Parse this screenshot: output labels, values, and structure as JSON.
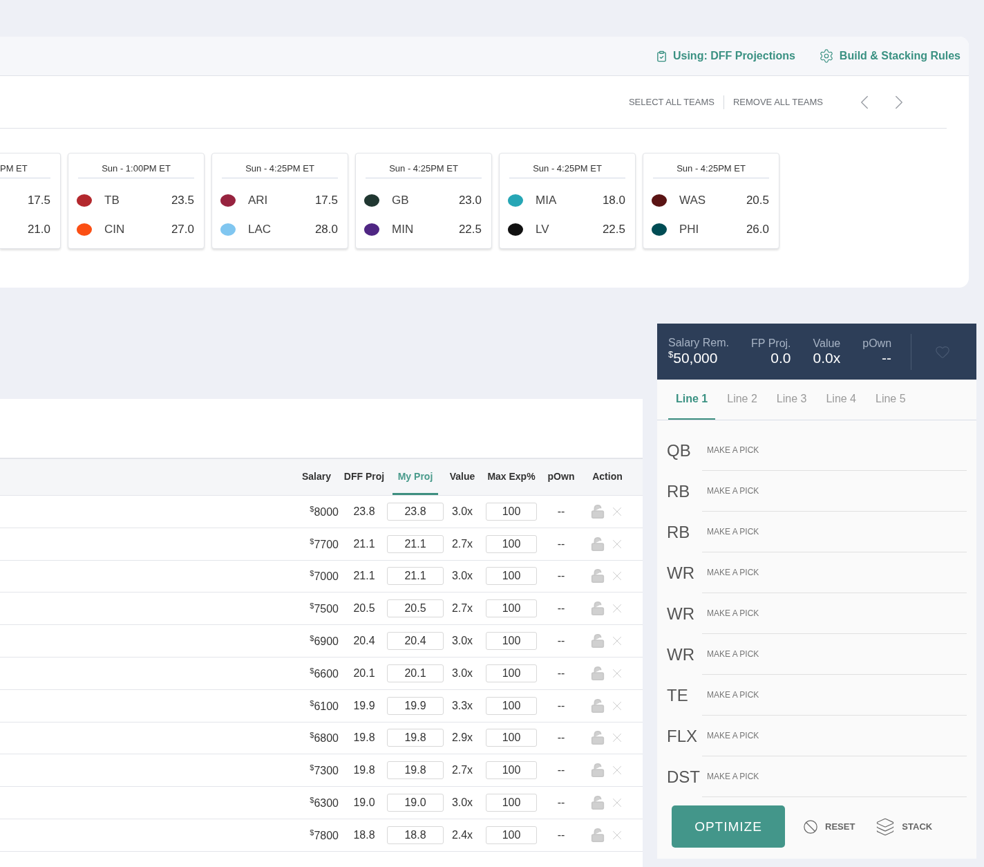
{
  "header_links": [
    {
      "kind": "projections",
      "label": "Using: DFF Projections"
    },
    {
      "kind": "rules",
      "label": "Build & Stacking Rules"
    }
  ],
  "team_actions": [
    "SELECT ALL TEAMS",
    "REMOVE ALL TEAMS"
  ],
  "games": [
    {
      "kind": "partial",
      "time": "PM ET",
      "teams": [
        {
          "score": "17.5"
        },
        {
          "score": "21.0"
        }
      ]
    },
    {
      "kind": "full",
      "time": "Sun - 1:00PM ET",
      "teams": [
        {
          "abbr": "TB",
          "score": "23.5",
          "color": "#b3282d"
        },
        {
          "abbr": "CIN",
          "score": "27.0",
          "color": "#fb4f14"
        }
      ]
    },
    {
      "kind": "full",
      "time": "Sun - 4:25PM ET",
      "teams": [
        {
          "abbr": "ARI",
          "score": "17.5",
          "color": "#97233f"
        },
        {
          "abbr": "LAC",
          "score": "28.0",
          "color": "#80c6f0"
        }
      ]
    },
    {
      "kind": "full",
      "time": "Sun - 4:25PM ET",
      "teams": [
        {
          "abbr": "GB",
          "score": "23.0",
          "color": "#203731"
        },
        {
          "abbr": "MIN",
          "score": "22.5",
          "color": "#4f2683"
        }
      ]
    },
    {
      "kind": "full",
      "time": "Sun - 4:25PM ET",
      "teams": [
        {
          "abbr": "MIA",
          "score": "18.0",
          "color": "#26a6b5"
        },
        {
          "abbr": "LV",
          "score": "22.5",
          "color": "#111111"
        }
      ]
    },
    {
      "kind": "full",
      "time": "Sun - 4:25PM ET",
      "teams": [
        {
          "abbr": "WAS",
          "score": "20.5",
          "color": "#5a1414"
        },
        {
          "abbr": "PHI",
          "score": "26.0",
          "color": "#004c54"
        }
      ]
    }
  ],
  "table": {
    "columns": [
      {
        "label": "Salary",
        "selected": false
      },
      {
        "label": "DFF Proj",
        "selected": false
      },
      {
        "label": "My Proj",
        "selected": true
      },
      {
        "label": "Value",
        "selected": false
      },
      {
        "label": "Max Exp%",
        "selected": false
      },
      {
        "label": "pOwn",
        "selected": false
      },
      {
        "label": "Action",
        "selected": false
      }
    ],
    "rows": [
      {
        "currency": "$",
        "salary": "8000",
        "dff_proj": "23.8",
        "my_proj": "23.8",
        "value": "3.0x",
        "max_exp": "100",
        "pown": "--"
      },
      {
        "currency": "$",
        "salary": "7700",
        "dff_proj": "21.1",
        "my_proj": "21.1",
        "value": "2.7x",
        "max_exp": "100",
        "pown": "--"
      },
      {
        "currency": "$",
        "salary": "7000",
        "dff_proj": "21.1",
        "my_proj": "21.1",
        "value": "3.0x",
        "max_exp": "100",
        "pown": "--"
      },
      {
        "currency": "$",
        "salary": "7500",
        "dff_proj": "20.5",
        "my_proj": "20.5",
        "value": "2.7x",
        "max_exp": "100",
        "pown": "--"
      },
      {
        "currency": "$",
        "salary": "6900",
        "dff_proj": "20.4",
        "my_proj": "20.4",
        "value": "3.0x",
        "max_exp": "100",
        "pown": "--"
      },
      {
        "currency": "$",
        "salary": "6600",
        "dff_proj": "20.1",
        "my_proj": "20.1",
        "value": "3.0x",
        "max_exp": "100",
        "pown": "--"
      },
      {
        "currency": "$",
        "salary": "6100",
        "dff_proj": "19.9",
        "my_proj": "19.9",
        "value": "3.3x",
        "max_exp": "100",
        "pown": "--"
      },
      {
        "currency": "$",
        "salary": "6800",
        "dff_proj": "19.8",
        "my_proj": "19.8",
        "value": "2.9x",
        "max_exp": "100",
        "pown": "--"
      },
      {
        "currency": "$",
        "salary": "7300",
        "dff_proj": "19.8",
        "my_proj": "19.8",
        "value": "2.7x",
        "max_exp": "100",
        "pown": "--"
      },
      {
        "currency": "$",
        "salary": "6300",
        "dff_proj": "19.0",
        "my_proj": "19.0",
        "value": "3.0x",
        "max_exp": "100",
        "pown": "--"
      },
      {
        "currency": "$",
        "salary": "7800",
        "dff_proj": "18.8",
        "my_proj": "18.8",
        "value": "2.4x",
        "max_exp": "100",
        "pown": "--"
      }
    ]
  },
  "lineup": {
    "stats": [
      {
        "label": "Salary Rem.",
        "currency": "$",
        "value": "50,000"
      },
      {
        "label": "FP Proj.",
        "value": "0.0"
      },
      {
        "label": "Value",
        "value": "0.0x"
      },
      {
        "label": "pOwn",
        "value": "--"
      }
    ],
    "tabs": [
      {
        "label": "Line 1",
        "selected": true
      },
      {
        "label": "Line 2",
        "selected": false
      },
      {
        "label": "Line 3",
        "selected": false
      },
      {
        "label": "Line 4",
        "selected": false
      },
      {
        "label": "Line 5",
        "selected": false
      }
    ],
    "slots": [
      {
        "position": "QB",
        "placeholder": "MAKE A PICK"
      },
      {
        "position": "RB",
        "placeholder": "MAKE A PICK"
      },
      {
        "position": "RB",
        "placeholder": "MAKE A PICK"
      },
      {
        "position": "WR",
        "placeholder": "MAKE A PICK"
      },
      {
        "position": "WR",
        "placeholder": "MAKE A PICK"
      },
      {
        "position": "WR",
        "placeholder": "MAKE A PICK"
      },
      {
        "position": "TE",
        "placeholder": "MAKE A PICK"
      },
      {
        "position": "FLX",
        "placeholder": "MAKE A PICK"
      },
      {
        "position": "DST",
        "placeholder": "MAKE A PICK"
      }
    ],
    "buttons": [
      {
        "kind": "primary",
        "label": "OPTIMIZE"
      },
      {
        "kind": "reset",
        "label": "RESET"
      },
      {
        "kind": "stack",
        "label": "STACK"
      }
    ]
  }
}
